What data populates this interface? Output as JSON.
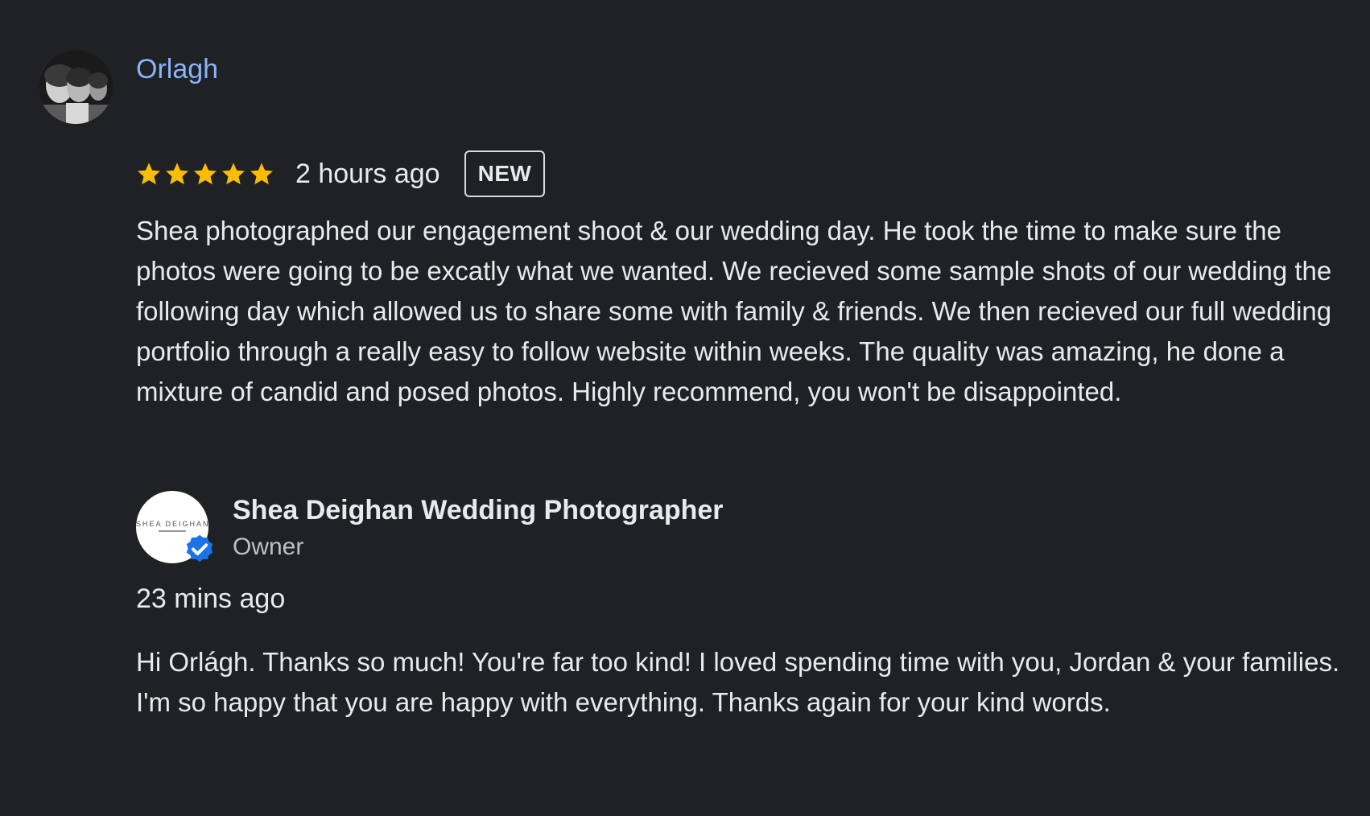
{
  "review": {
    "reviewer_name": "Orlagh",
    "rating": 5,
    "rating_max": 5,
    "time_ago": "2 hours ago",
    "badge": "NEW",
    "text": "Shea photographed our engagement shoot & our wedding day. He took the time to make sure the photos were going to be excatly what we wanted. We recieved some sample shots of our wedding the following day which allowed us to share some with family & friends. We then recieved our full wedding portfolio through a really easy to follow website within weeks. The quality was amazing, he done a mixture of candid and posed photos. Highly recommend, you won't be disappointed."
  },
  "owner_reply": {
    "owner_name": "Shea Deighan Wedding Photographer",
    "role": "Owner",
    "avatar_logo_text": "SHEA DEIGHAN",
    "time_ago": "23 mins ago",
    "text": "Hi Orlágh. Thanks so much! You're far too kind! I loved spending time with you, Jordan & your families. I'm so happy that you are happy with everything. Thanks again for your kind words."
  },
  "colors": {
    "background": "#202124",
    "reviewer_name": "#8ab4f8",
    "star": "#fbbc04",
    "text": "#e8eaed",
    "verified": "#1a73e8"
  },
  "icons": {
    "star": "star-icon",
    "verified": "verified-check-icon"
  }
}
